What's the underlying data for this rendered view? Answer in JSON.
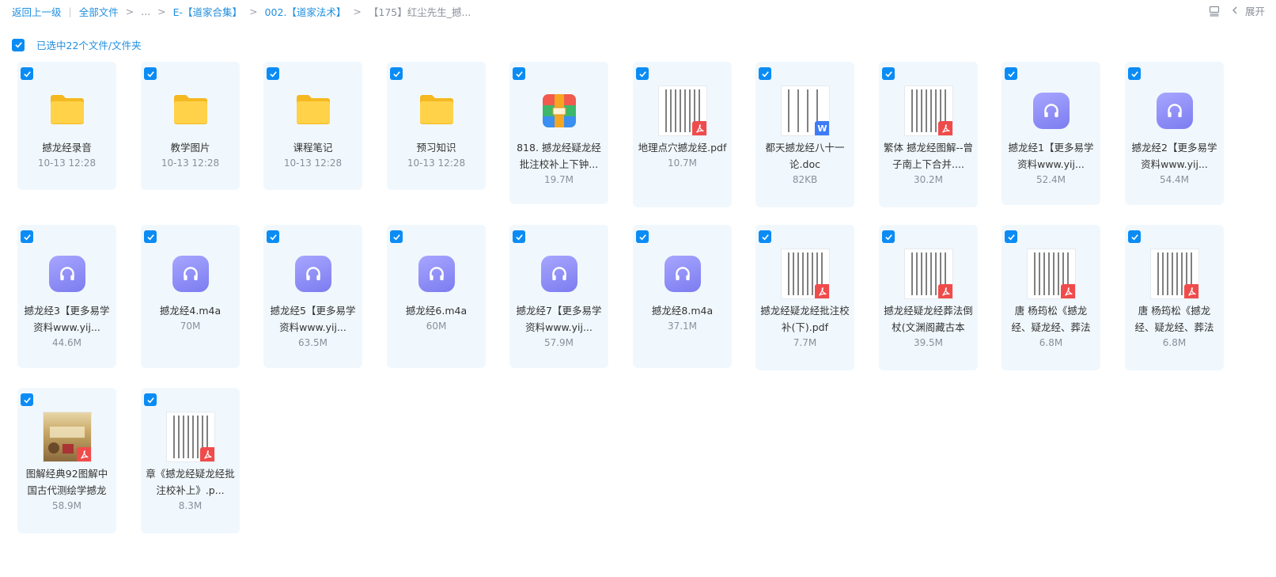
{
  "breadcrumb": {
    "back": "返回上一级",
    "all": "全部文件",
    "ellipsis": "...",
    "level1": "E-【道家合集】",
    "level2": "002.【道家法术】",
    "current": "【175】红尘先生_撼..."
  },
  "topRight": {
    "expand": "展开"
  },
  "selection": {
    "text": "已选中22个文件/文件夹"
  },
  "colors": {
    "accent": "#0b8cf5",
    "cardBg": "#f1f8fd",
    "link": "#1f8fe0",
    "pdf": "#f04b4b",
    "word": "#3d7cf6"
  },
  "files": [
    {
      "name": "撼龙经录音",
      "meta": "10-13 12:28",
      "type": "folder"
    },
    {
      "name": "教学图片",
      "meta": "10-13 12:28",
      "type": "folder"
    },
    {
      "name": "课程笔记",
      "meta": "10-13 12:28",
      "type": "folder"
    },
    {
      "name": "预习知识",
      "meta": "10-13 12:28",
      "type": "folder"
    },
    {
      "name": "818. 撼龙经疑龙经批注校补上下钟...",
      "meta": "19.7M",
      "type": "zip"
    },
    {
      "name": "地理点穴撼龙经.pdf",
      "meta": "10.7M",
      "type": "pdf"
    },
    {
      "name": "都天撼龙经八十一论.doc",
      "meta": "82KB",
      "type": "doc"
    },
    {
      "name": "繁体 撼龙经图解--曾子南上下合并....",
      "meta": "30.2M",
      "type": "pdf"
    },
    {
      "name": "撼龙经1【更多易学资料www.yij...",
      "meta": "52.4M",
      "type": "audio"
    },
    {
      "name": "撼龙经2【更多易学资料www.yij...",
      "meta": "54.4M",
      "type": "audio"
    },
    {
      "name": "撼龙经3【更多易学资料www.yij...",
      "meta": "44.6M",
      "type": "audio"
    },
    {
      "name": "撼龙经4.m4a",
      "meta": "70M",
      "type": "audio"
    },
    {
      "name": "撼龙经5【更多易学资料www.yij...",
      "meta": "63.5M",
      "type": "audio"
    },
    {
      "name": "撼龙经6.m4a",
      "meta": "60M",
      "type": "audio"
    },
    {
      "name": "撼龙经7【更多易学资料www.yij...",
      "meta": "57.9M",
      "type": "audio"
    },
    {
      "name": "撼龙经8.m4a",
      "meta": "37.1M",
      "type": "audio"
    },
    {
      "name": "撼龙经疑龙经批注校补(下).pdf",
      "meta": "7.7M",
      "type": "pdf"
    },
    {
      "name": "撼龙经疑龙经葬法倒杖(文渊阁藏古本",
      "meta": "39.5M",
      "type": "pdf"
    },
    {
      "name": "唐 杨筠松《撼龙经、疑龙经、葬法",
      "meta": "6.8M",
      "type": "pdf"
    },
    {
      "name": "唐 杨筠松《撼龙经、疑龙经、葬法",
      "meta": "6.8M",
      "type": "pdf"
    },
    {
      "name": "图解经典92图解中国古代测绘学撼龙",
      "meta": "58.9M",
      "type": "pdfcover"
    },
    {
      "name": "章《撼龙经疑龙经批注校补上》.p...",
      "meta": "8.3M",
      "type": "pdf"
    }
  ]
}
